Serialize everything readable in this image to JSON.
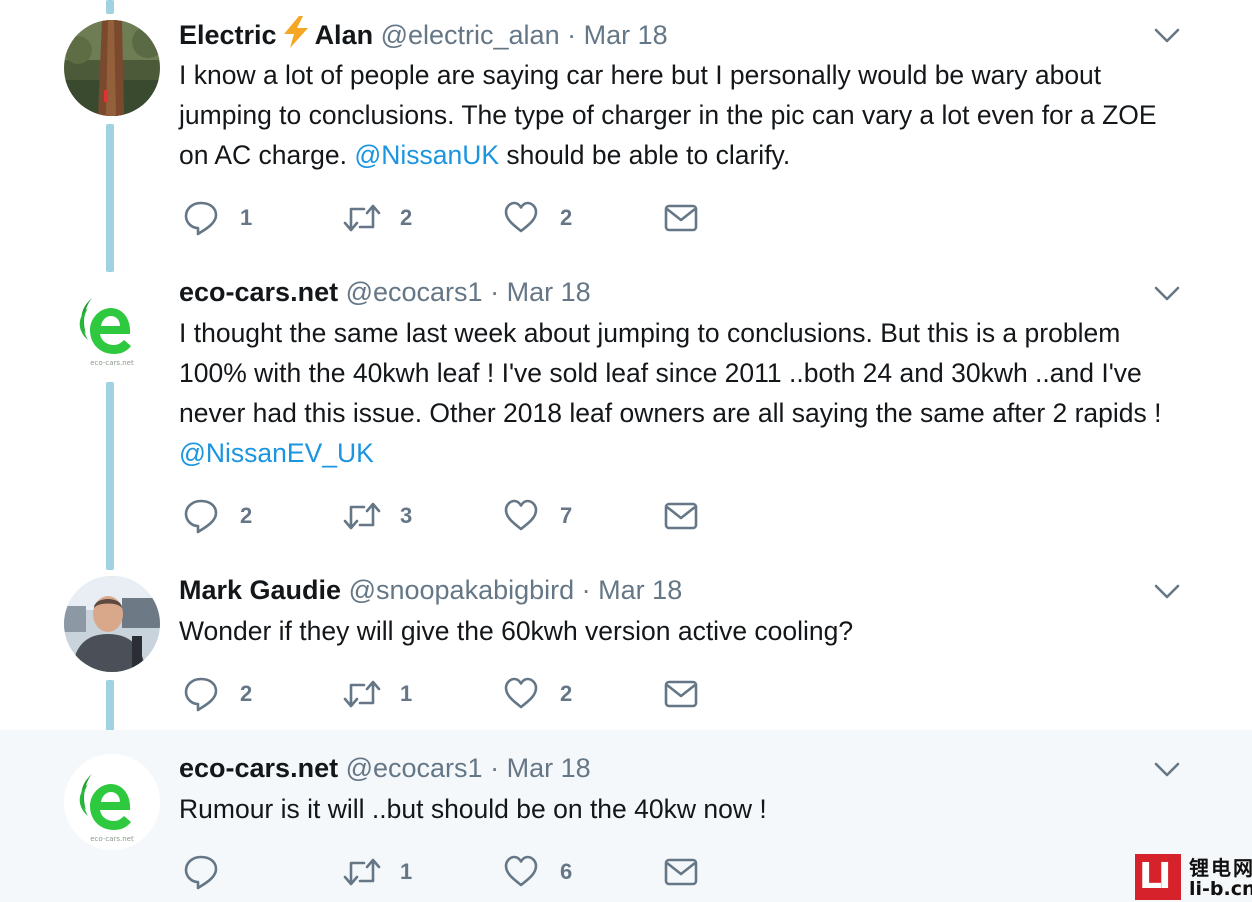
{
  "tweets": [
    {
      "name_part1": "Electric",
      "name_part2": "Alan",
      "handle": "@electric_alan",
      "separator": "·",
      "date": "Mar 18",
      "text_before": "I know a lot of people are saying car here but I personally would be wary about jumping to conclusions. The type of charger in the pic can vary a lot even for a ZOE on AC charge. ",
      "mention": "@NissanUK",
      "text_after": " should be able to clarify.",
      "replies": "1",
      "retweets": "2",
      "likes": "2"
    },
    {
      "name": "eco-cars.net",
      "handle": "@ecocars1",
      "separator": "·",
      "date": "Mar 18",
      "text_before": "I thought the same last week about jumping to conclusions. But this is a problem 100% with the 40kwh leaf ! I've sold leaf since 2011 ..both 24 and 30kwh ..and I've never had this issue. Other 2018 leaf owners are all saying the same after 2 rapids ! ",
      "mention": "@NissanEV_UK",
      "text_after": "",
      "replies": "2",
      "retweets": "3",
      "likes": "7",
      "avatar_caption": "eco-cars.net"
    },
    {
      "name": "Mark Gaudie",
      "handle": "@snoopakabigbird",
      "separator": "·",
      "date": "Mar 18",
      "text": "Wonder if they will give the 60kwh version active cooling?",
      "replies": "2",
      "retweets": "1",
      "likes": "2"
    },
    {
      "name": "eco-cars.net",
      "handle": "@ecocars1",
      "separator": "·",
      "date": "Mar 18",
      "text": "Rumour is it will ..but should be on the 40kw now !",
      "replies": "",
      "retweets": "1",
      "likes": "6",
      "avatar_caption": "eco-cars.net"
    }
  ],
  "watermark": {
    "logo_letters": "LI",
    "chinese": "锂电网",
    "domain": "li-b.cn"
  },
  "colors": {
    "text": "#14171a",
    "muted": "#657786",
    "link": "#1b95e0",
    "thread_line": "#9fd3e2",
    "highlight_bg": "#f5f8fa",
    "eco_green": "#2fc93f"
  },
  "icons": {
    "reply": "speech-bubble-icon",
    "retweet": "retweet-arrows-icon",
    "like": "heart-icon",
    "dm": "envelope-icon",
    "more": "chevron-down-icon",
    "bolt": "lightning-bolt-emoji"
  }
}
